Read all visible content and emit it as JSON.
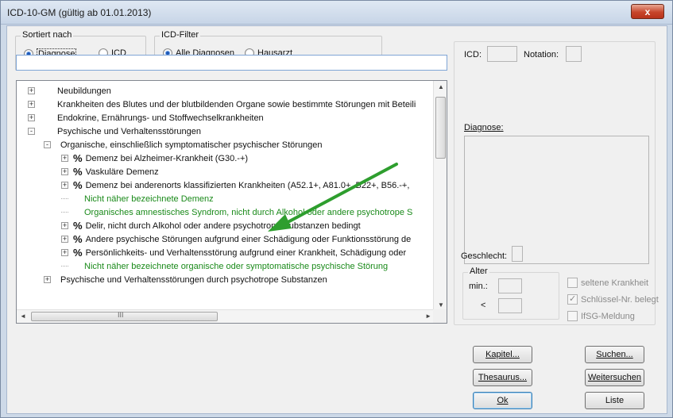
{
  "window": {
    "title": "ICD-10-GM (gültig ab 01.01.2013)",
    "close_glyph": "x"
  },
  "sort": {
    "group_label": "Sortiert nach",
    "options": [
      "Diagnose",
      "ICD"
    ],
    "selected": "Diagnose"
  },
  "filter": {
    "group_label": "ICD-Filter",
    "options": [
      "Alle Diagnosen",
      "Hausarzt"
    ],
    "selected": "Alle Diagnosen"
  },
  "search": {
    "value": ""
  },
  "tree": {
    "rows": [
      {
        "text": "Neubildungen",
        "level": 0,
        "expander": "+",
        "percent": false,
        "green": false
      },
      {
        "text": "Krankheiten des Blutes und der blutbildenden Organe sowie bestimmte Störungen mit Beteili",
        "level": 0,
        "expander": "+",
        "percent": false,
        "green": false
      },
      {
        "text": "Endokrine, Ernährungs- und Stoffwechselkrankheiten",
        "level": 0,
        "expander": "+",
        "percent": false,
        "green": false
      },
      {
        "text": "Psychische und Verhaltensstörungen",
        "level": 0,
        "expander": "-",
        "percent": false,
        "green": false
      },
      {
        "text": "Organische, einschließlich symptomatischer psychischer Störungen",
        "level": 1,
        "expander": "-",
        "percent": false,
        "green": false
      },
      {
        "text": "Demenz bei Alzheimer-Krankheit  (G30.-+)",
        "level": 2,
        "expander": "+",
        "percent": true,
        "green": false
      },
      {
        "text": "Vaskuläre Demenz",
        "level": 2,
        "expander": "+",
        "percent": true,
        "green": false
      },
      {
        "text": "Demenz bei anderenorts klassifizierten Krankheiten (A52.1+, A81.0+, B22+, B56.-+,",
        "level": 2,
        "expander": "+",
        "percent": true,
        "green": false
      },
      {
        "text": "Nicht näher bezeichnete Demenz",
        "level": 2,
        "expander": "",
        "percent": false,
        "green": true
      },
      {
        "text": "Organisches amnestisches Syndrom, nicht durch Alkohol oder andere psychotrope S",
        "level": 2,
        "expander": "",
        "percent": false,
        "green": true
      },
      {
        "text": "Delir, nicht durch Alkohol oder andere psychotrope Substanzen bedingt",
        "level": 2,
        "expander": "+",
        "percent": true,
        "green": false
      },
      {
        "text": "Andere psychische Störungen aufgrund einer Schädigung oder Funktionsstörung de",
        "level": 2,
        "expander": "+",
        "percent": true,
        "green": false
      },
      {
        "text": "Persönlichkeits- und Verhaltensstörung aufgrund einer Krankheit, Schädigung oder",
        "level": 2,
        "expander": "+",
        "percent": true,
        "green": false
      },
      {
        "text": "Nicht näher bezeichnete organische oder symptomatische psychische Störung",
        "level": 2,
        "expander": "",
        "percent": false,
        "green": true
      },
      {
        "text": "Psychische und Verhaltensstörungen durch psychotrope Substanzen",
        "level": 1,
        "expander": "+",
        "percent": false,
        "green": false
      }
    ],
    "hscroll_glyph": "III"
  },
  "details": {
    "icd_label": "ICD:",
    "notation_label": "Notation:",
    "diagnose_label": "Diagnose:",
    "geschlecht_label": "Geschlecht:",
    "alter_label": "Alter",
    "min_label": "min.:",
    "lt_label": "<",
    "checks": [
      {
        "label": "seltene Krankheit",
        "checked": false
      },
      {
        "label": "Schlüssel-Nr. belegt",
        "checked": true
      },
      {
        "label": "IfSG-Meldung",
        "checked": false
      }
    ]
  },
  "buttons": {
    "kapitel": "Kapitel...",
    "suchen": "Suchen...",
    "thesaurus": "Thesaurus...",
    "weitersuchen": "Weitersuchen",
    "ok": "Ok",
    "liste": "Liste"
  },
  "colors": {
    "arrow": "#2e9e2e",
    "green_text": "#1a8a1a"
  }
}
